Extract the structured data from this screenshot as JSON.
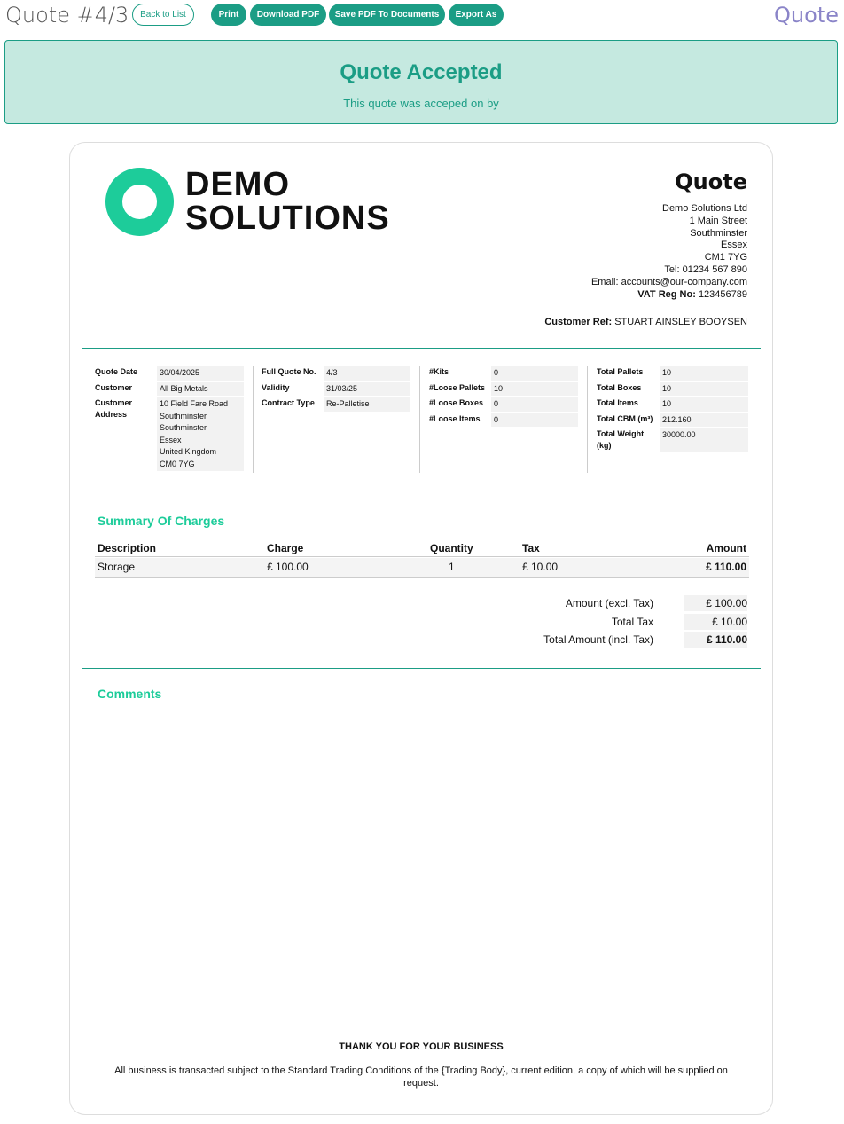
{
  "header": {
    "title": "Quote #4/3",
    "back_label": "Back to List",
    "buttons": [
      "Print",
      "Download PDF",
      "Save PDF To Documents",
      "Export As"
    ],
    "right_title": "Quote"
  },
  "banner": {
    "title": "Quote Accepted",
    "subtitle": "This quote was acceped on by"
  },
  "document": {
    "logo_line1": "DEMO",
    "logo_line2": "SOLUTIONS",
    "heading": "Quote",
    "company": {
      "name": "Demo Solutions Ltd",
      "street": "1 Main Street",
      "town": "Southminster",
      "county": "Essex",
      "postcode": "CM1 7YG",
      "tel": "Tel: 01234 567 890",
      "email": "Email: accounts@our-company.com",
      "vat_label": "VAT Reg No:",
      "vat_value": "123456789"
    },
    "customer_ref_label": "Customer Ref:",
    "customer_ref_value": "STUART AINSLEY BOOYSEN",
    "info": {
      "col1": {
        "quote_date_label": "Quote Date",
        "quote_date": "30/04/2025",
        "customer_label": "Customer",
        "customer": "All Big Metals",
        "address_label_1": "Customer",
        "address_label_2": "Address",
        "address": [
          "10 Field Fare Road",
          "Southminster",
          "Southminster",
          "Essex",
          "United Kingdom",
          "CM0 7YG"
        ]
      },
      "col2": {
        "full_no_label": "Full Quote No.",
        "full_no": "4/3",
        "validity_label": "Validity",
        "validity": "31/03/25",
        "contract_label": "Contract Type",
        "contract": "Re-Palletise"
      },
      "col3": {
        "kits_label": "#Kits",
        "kits": "0",
        "loose_pallets_label": "#Loose Pallets",
        "loose_pallets": "10",
        "loose_boxes_label": "#Loose Boxes",
        "loose_boxes": "0",
        "loose_items_label": "#Loose Items",
        "loose_items": "0"
      },
      "col4": {
        "pallets_label": "Total Pallets",
        "pallets": "10",
        "boxes_label": "Total Boxes",
        "boxes": "10",
        "items_label": "Total Items",
        "items": "10",
        "cbm_label": "Total CBM (m³)",
        "cbm": "212.160",
        "weight_label_1": "Total Weight",
        "weight_label_2": "(kg)",
        "weight": "30000.00"
      }
    },
    "summary_title": "Summary Of Charges",
    "charges_headers": [
      "Description",
      "Charge",
      "Quantity",
      "Tax",
      "Amount"
    ],
    "charges_rows": [
      {
        "description": "Storage",
        "charge": "£ 100.00",
        "quantity": "1",
        "tax": "£ 10.00",
        "amount": "£ 110.00"
      }
    ],
    "totals": {
      "excl_label": "Amount (excl. Tax)",
      "excl": "£ 100.00",
      "tax_label": "Total Tax",
      "tax": "£ 10.00",
      "incl_label": "Total Amount (incl. Tax)",
      "incl": "£ 110.00"
    },
    "comments_title": "Comments",
    "thanks": "THANK YOU FOR YOUR BUSINESS",
    "terms": "All business is transacted subject to the Standard Trading Conditions of the {Trading Body}, current edition, a copy of which will be supplied on request."
  },
  "colors": {
    "accent": "#1b9d85",
    "logo": "#1dcc9a",
    "banner_bg": "#c5e9e0",
    "title_purple": "#8a84c8"
  }
}
